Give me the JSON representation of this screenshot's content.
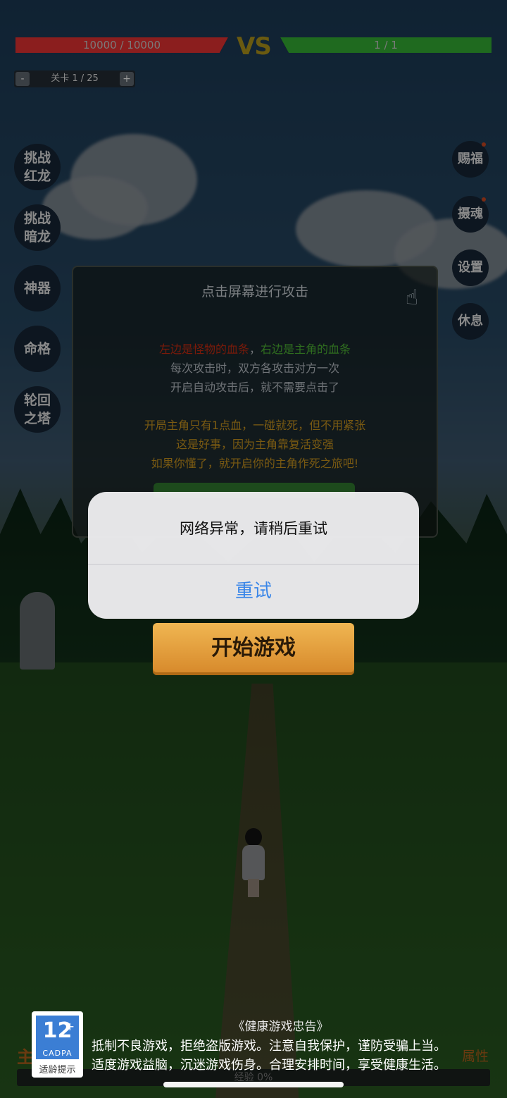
{
  "hud": {
    "enemy_hp": "10000 / 10000",
    "enemy_hp_fraction": 1.0,
    "vs": "VS",
    "player_hp": "1 / 1",
    "player_hp_fraction": 1.0,
    "level": {
      "minus": "-",
      "label": "关卡 1 / 25",
      "plus": "+"
    }
  },
  "left_menu": [
    {
      "line1": "挑战",
      "line2": "红龙"
    },
    {
      "line1": "挑战",
      "line2": "暗龙"
    },
    {
      "line1": "神器",
      "line2": ""
    },
    {
      "line1": "命格",
      "line2": ""
    },
    {
      "line1": "轮回",
      "line2": "之塔"
    }
  ],
  "right_menu": [
    {
      "label": "赐福"
    },
    {
      "label": "摄魂"
    },
    {
      "label": "设置"
    },
    {
      "label": "休息"
    }
  ],
  "tutorial": {
    "title": "点击屏幕进行攻击",
    "line1_red": "左边是怪物的血条",
    "line1_sep": "，",
    "line1_green": "右边是主角的血条",
    "line2": "每次攻击时，双方各攻击对方一次",
    "line3": "开启自动攻击后，就不需要点击了",
    "line4": "开局主角只有1点血，一碰就死，但不用紧张",
    "line5": "这是好事，因为主角靠复活变强",
    "line6": "如果你懂了，就开启你的主角作死之旅吧!"
  },
  "start_button": "开始游戏",
  "dialog": {
    "message": "网络异常，请稍后重试",
    "retry": "重试"
  },
  "bottom": {
    "left_text": "主",
    "right_text": "属性",
    "exp": "经验 0%"
  },
  "age_rating": {
    "number": "12",
    "plus": "+",
    "org": "CADPA",
    "tip": "适龄提示"
  },
  "health_notice": {
    "title": "《健康游戏忠告》",
    "line1": "抵制不良游戏，拒绝盗版游戏。注意自我保护，谨防受骗上当。",
    "line2": "适度游戏益脑，沉迷游戏伤身。合理安排时间，享受健康生活。"
  },
  "colors": {
    "retry_blue": "#3a86e8",
    "start_orange": "#e9a23e",
    "cadpa_blue": "#3b7ed4"
  }
}
